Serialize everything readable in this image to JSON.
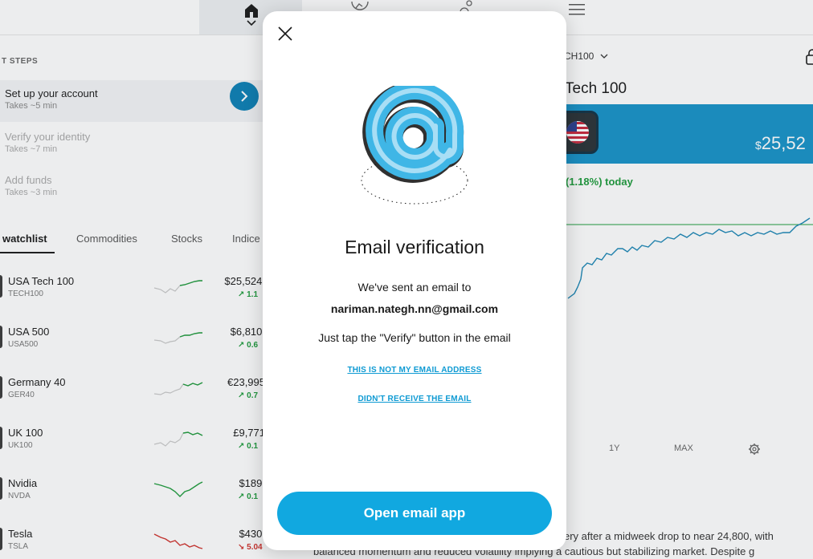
{
  "colors": {
    "accent": "#11a8e0",
    "link": "#0e9ad3",
    "positive": "#1e9b3b",
    "negative": "#d0302b",
    "banner": "#1792c8"
  },
  "topbar": {
    "icons": [
      "home-icon",
      "chevron-down-icon",
      "chart-icon",
      "people-icon",
      "menu-icon"
    ]
  },
  "next_steps": {
    "title": "T STEPS",
    "items": [
      {
        "label": "Set up your account",
        "sub": "Takes ~5 min"
      },
      {
        "label": "Verify your identity",
        "sub": "Takes ~7 min"
      },
      {
        "label": "Add funds",
        "sub": "Takes ~3 min"
      }
    ]
  },
  "watchlist": {
    "tabs": [
      "watchlist",
      "Commodities",
      "Stocks",
      "Indice"
    ],
    "rows": [
      {
        "name": "USA Tech 100",
        "ticker": "TECH100",
        "price": "$25,524.",
        "change": "↗ 1.1",
        "dir": "up"
      },
      {
        "name": "USA 500",
        "ticker": "USA500",
        "price": "$6,810.",
        "change": "↗ 0.6",
        "dir": "up"
      },
      {
        "name": "Germany 40",
        "ticker": "GER40",
        "price": "€23,995",
        "change": "↗ 0.7",
        "dir": "up"
      },
      {
        "name": "UK 100",
        "ticker": "UK100",
        "price": "£9,771",
        "change": "↗ 0.1",
        "dir": "up"
      },
      {
        "name": "Nvidia",
        "ticker": "NVDA",
        "price": "$189.",
        "change": "↗ 0.1",
        "dir": "up"
      },
      {
        "name": "Tesla",
        "ticker": "TSLA",
        "price": "$430.",
        "change": "↘ 5.04",
        "dir": "down"
      }
    ]
  },
  "instrument": {
    "selector": "CH100",
    "title": "Tech 100",
    "price_symbol": "$",
    "price": "25,52",
    "today_change": "(1.18%) today",
    "ranges": [
      "1Y",
      "MAX"
    ],
    "description_line1": "ery after a midweek drop to near 24,800, with",
    "description_line2": "balanced momentum and reduced volatility implying a cautious but stabilizing market. Despite g"
  },
  "modal": {
    "title": "Email verification",
    "sent_line": "We've sent an email to",
    "email": "nariman.nategh.nn@gmail.com",
    "tap_line": "Just tap the \"Verify\" button in the email",
    "link_not_mine": "THIS IS NOT MY EMAIL ADDRESS",
    "link_not_received": "DIDN'T RECEIVE THE EMAIL",
    "open_button": "Open email app"
  }
}
